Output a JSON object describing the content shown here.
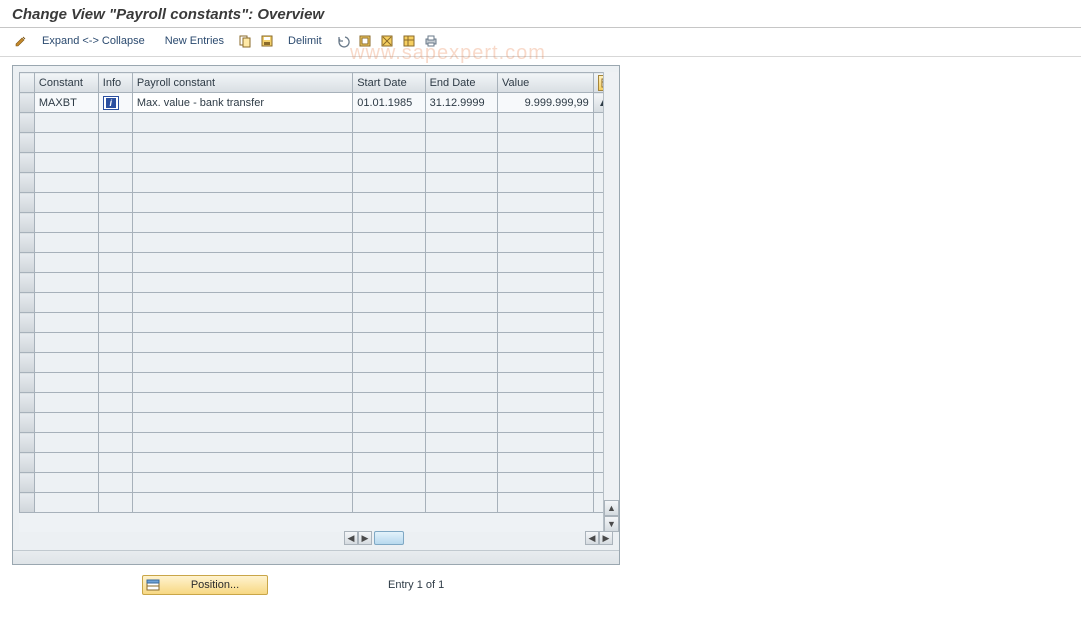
{
  "title": "Change View \"Payroll constants\": Overview",
  "watermark": "www.sapexpert.com",
  "toolbar": {
    "expand_collapse": "Expand <-> Collapse",
    "new_entries": "New Entries",
    "delimit": "Delimit"
  },
  "columns": {
    "constant": "Constant",
    "info": "Info",
    "payroll_constant": "Payroll constant",
    "start_date": "Start Date",
    "end_date": "End Date",
    "value": "Value"
  },
  "rows": [
    {
      "constant": "MAXBT",
      "info_icon": "info",
      "payroll_constant": "Max. value - bank transfer",
      "start_date": "01.01.1985",
      "end_date": "31.12.9999",
      "value": "9.999.999,99"
    }
  ],
  "footer": {
    "position_label": "Position...",
    "entry_text": "Entry 1 of 1"
  }
}
